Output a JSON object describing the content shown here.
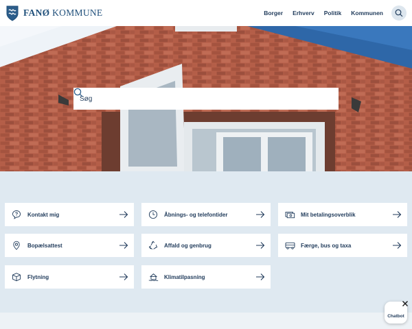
{
  "header": {
    "logo": {
      "bold": "FANØ",
      "rest": " KOMMUNE",
      "icon": "coat-of-arms-icon"
    },
    "nav": [
      "Borger",
      "Erhverv",
      "Politik",
      "Kommunen"
    ],
    "search_icon": "search-icon"
  },
  "hero": {
    "search": {
      "placeholder": "Søg",
      "value": "",
      "icon": "search-icon"
    }
  },
  "shortcuts": [
    {
      "label": "Kontakt mig",
      "icon": "question-bubble-icon"
    },
    {
      "label": "Åbnings- og telefontider",
      "icon": "clock-icon"
    },
    {
      "label": "Mit betalingsoverblik",
      "icon": "money-icon"
    },
    {
      "label": "Bopælsattest",
      "icon": "location-pin-icon"
    },
    {
      "label": "Affald og genbrug",
      "icon": "recycle-icon"
    },
    {
      "label": "Færge, bus og taxa",
      "icon": "bus-icon"
    },
    {
      "label": "Flytning",
      "icon": "moving-box-icon"
    },
    {
      "label": "Klimatilpasning",
      "icon": "climate-house-icon"
    }
  ],
  "chatbot": {
    "label": "Chatbot",
    "close_icon": "close-icon"
  },
  "colors": {
    "primary": "#1f3a5a",
    "logo": "#1f4f7a",
    "page_bg": "#dfe9f1",
    "card_bg": "#ffffff"
  }
}
